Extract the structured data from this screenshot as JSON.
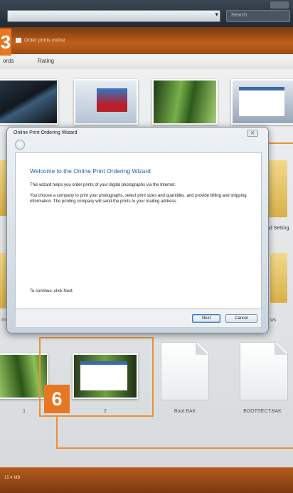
{
  "window": {
    "search_placeholder": "Search",
    "address_dropdown_glyph": "▾"
  },
  "toolbar": {
    "order_prints_label": "Order prints online"
  },
  "columns": [
    "ords",
    "Rating"
  ],
  "files": [
    {
      "name": "1",
      "kind": "image"
    },
    {
      "name": "2",
      "kind": "image"
    },
    {
      "name": "Boot.BAK",
      "kind": "document"
    },
    {
      "name": "BOOTSECT.BAK",
      "kind": "document"
    }
  ],
  "partial_labels": {
    "settings": "nd Setting",
    "ins": "Ins",
    "ws": "ws"
  },
  "status_bar": {
    "size": "15.4 MB"
  },
  "callouts": {
    "step_top": "3",
    "step_bottom": "6"
  },
  "dialog": {
    "title": "Online Print Ordering Wizard",
    "close_glyph": "✕",
    "heading": "Welcome to the Online Print Ordering Wizard",
    "paragraph1": "This wizard helps you order prints of your digital photographs via the Internet.",
    "paragraph2": "You choose a company to print your photographs, select print sizes and quantities, and provide billing and shipping information. The printing company will send the prints to your mailing address.",
    "continue_text": "To continue, click Next.",
    "next_label": "Next",
    "cancel_label": "Cancel"
  },
  "colors": {
    "accent_orange": "#e87722",
    "dialog_heading_blue": "#1f5faa",
    "toolbar_orange": "#c0601c"
  }
}
